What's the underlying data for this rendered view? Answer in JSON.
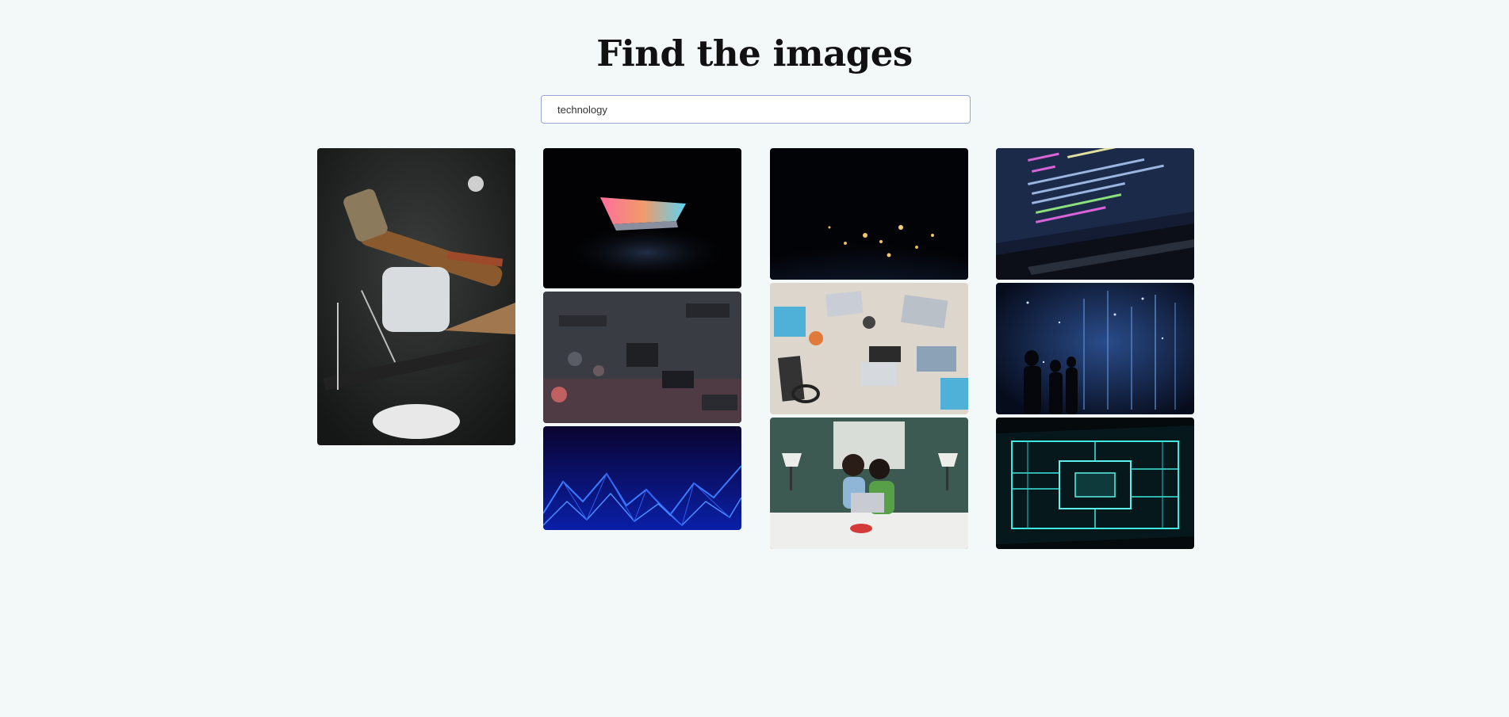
{
  "page": {
    "title": "Find the images"
  },
  "search": {
    "value": "technology"
  },
  "images": [
    {
      "id": "tools",
      "description": "tools-on-dark-desk"
    },
    {
      "id": "laptop-glow",
      "description": "laptop-glowing-in-dark"
    },
    {
      "id": "circuit-board",
      "description": "circuit-board-closeup"
    },
    {
      "id": "blue-mesh",
      "description": "blue-network-mesh"
    },
    {
      "id": "earth-night",
      "description": "earth-lights-at-night"
    },
    {
      "id": "team-desk",
      "description": "team-laptops-on-table"
    },
    {
      "id": "couple-laptop",
      "description": "couple-with-laptop-on-bed"
    },
    {
      "id": "code-screen",
      "description": "code-on-laptop-screen"
    },
    {
      "id": "digital-rain",
      "description": "people-in-digital-rain"
    },
    {
      "id": "neon-circuit",
      "description": "neon-circuit-pattern"
    }
  ]
}
